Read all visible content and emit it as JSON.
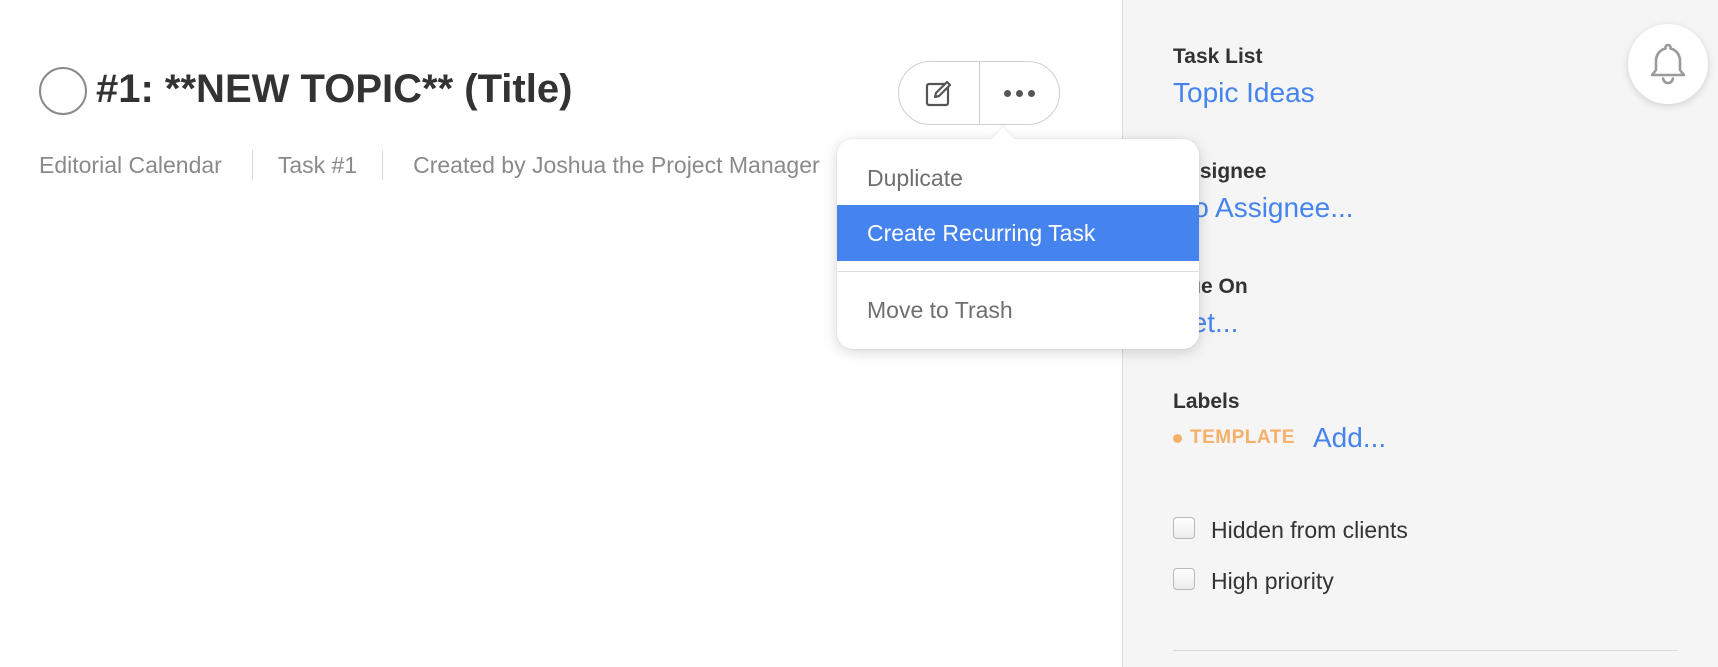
{
  "task": {
    "title": "#1: **NEW TOPIC** (Title)",
    "project": "Editorial Calendar",
    "number": "Task #1",
    "created_by": "Created by Joshua the Project Manager"
  },
  "toolbar": {
    "edit_icon": "edit-icon",
    "more_icon": "more-options-icon"
  },
  "menu": {
    "items": [
      {
        "label": "Duplicate"
      },
      {
        "label": "Create Recurring Task",
        "highlighted": true
      },
      {
        "label": "Move to Trash"
      }
    ],
    "highlight_color": "#4584ee"
  },
  "side": {
    "task_list_label": "Task List",
    "task_list_value": "Topic Ideas",
    "assignee_label": "Assignee",
    "assignee_value": "No Assignee...",
    "due_on_label": "Due On",
    "due_on_value": "Set...",
    "labels_label": "Labels",
    "label_tag": "TEMPLATE",
    "label_tag_color": "#f5b06a",
    "add_label": "Add...",
    "hidden_from_clients": "Hidden from clients",
    "high_priority": "High priority"
  },
  "colors": {
    "accent": "#4584ee",
    "side_bg": "#f5f5f5"
  }
}
